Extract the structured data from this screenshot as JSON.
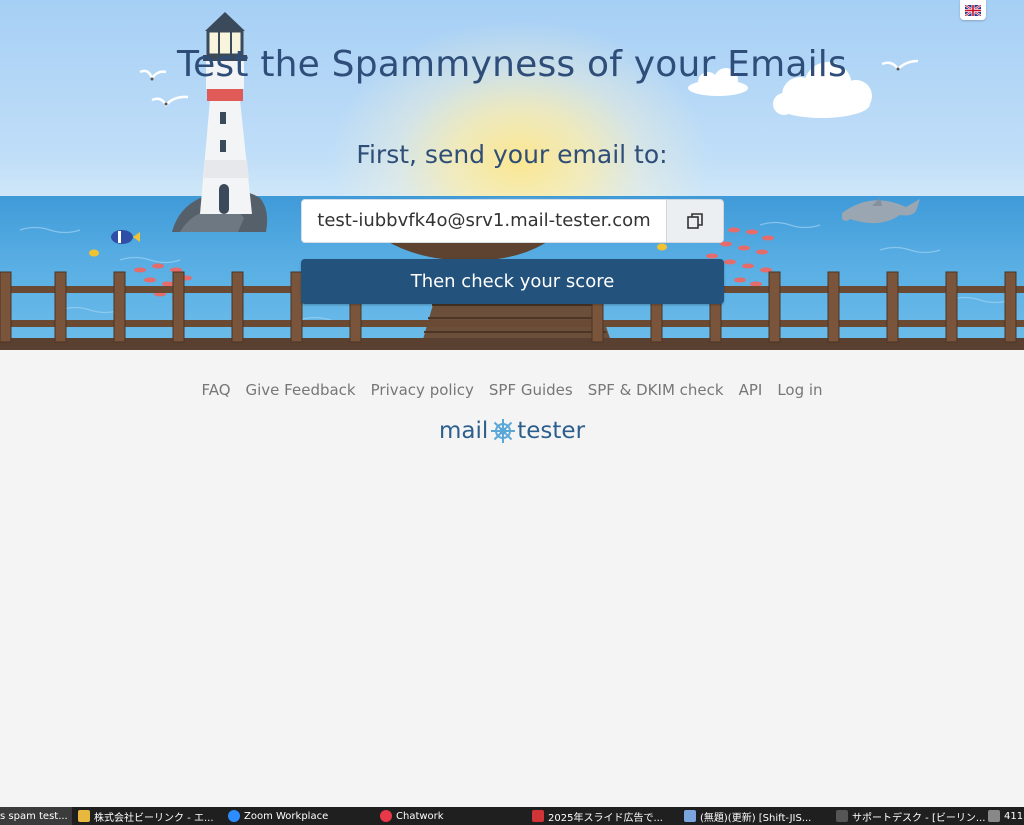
{
  "hero": {
    "title": "Test the Spammyness of your Emails",
    "subtitle": "First, send your email to:",
    "email": "test-iubbvfk4o@srv1.mail-tester.com",
    "check_button": "Then check your score",
    "accent_color": "#23527c"
  },
  "language_flag": "uk-flag-icon",
  "footer": {
    "links": [
      "FAQ",
      "Give Feedback",
      "Privacy policy",
      "SPF Guides",
      "SPF & DKIM check",
      "API",
      "Log in"
    ],
    "brand_left": "mail",
    "brand_right": "tester"
  },
  "taskbar": {
    "items": [
      {
        "label": "s spam test...",
        "icon": "browser-icon",
        "color": "#4a4a4a"
      },
      {
        "label": "株式会社ビーリンク - エ...",
        "icon": "folder-icon",
        "color": "#e7b83b"
      },
      {
        "label": "Zoom Workplace",
        "icon": "zoom-icon",
        "color": "#2d8cff"
      },
      {
        "label": "Chatwork",
        "icon": "chatwork-icon",
        "color": "#e9384a"
      },
      {
        "label": "2025年スライド広告で...",
        "icon": "app-red-icon",
        "color": "#d13438"
      },
      {
        "label": "(無題)(更新) [Shift-JIS...",
        "icon": "editor-icon",
        "color": "#7aa6e0"
      },
      {
        "label": "サポートデスク - [ビーリン...",
        "icon": "support-icon",
        "color": "#333333"
      },
      {
        "label": "411",
        "icon": "mail-app-icon",
        "color": "#888888"
      }
    ]
  }
}
